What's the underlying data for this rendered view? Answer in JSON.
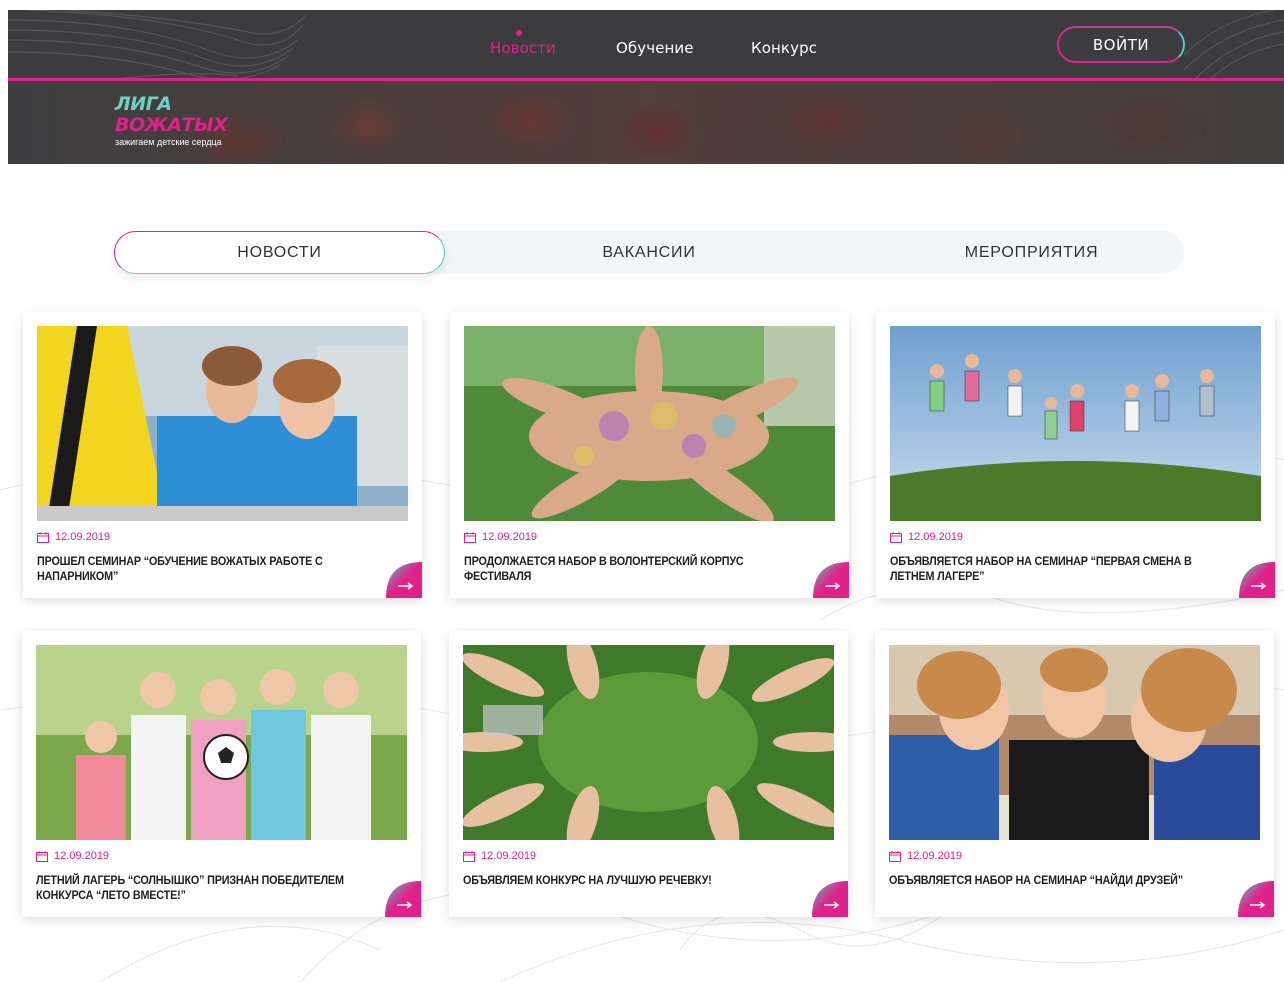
{
  "header": {
    "nav": [
      {
        "label": "Новости",
        "active": true
      },
      {
        "label": "Обучение",
        "active": false
      },
      {
        "label": "Конкурс",
        "active": false
      }
    ],
    "login_label": "ВОЙТИ",
    "logo": {
      "line1": "ЛИГА",
      "line2": "ВОЖАТЫХ",
      "tagline": "зажигаем детские сердца"
    }
  },
  "tabs": [
    {
      "label": "НОВОСТИ",
      "active": true
    },
    {
      "label": "ВАКАНСИИ",
      "active": false
    },
    {
      "label": "МЕРОПРИЯТИЯ",
      "active": false
    }
  ],
  "news": [
    {
      "date": "12.09.2019",
      "title": "ПРОШЕЛ СЕМИНАР “ОБУЧЕНИЕ ВОЖАТЫХ РАБОТЕ С НАПАРНИКОМ”",
      "image": "counselors-photo"
    },
    {
      "date": "12.09.2019",
      "title": "ПРОДОЛЖАЕТСЯ НАБОР В ВОЛОНТЕРСКИЙ КОРПУС ФЕСТИВАЛЯ",
      "image": "painted-hands-photo"
    },
    {
      "date": "12.09.2019",
      "title": "ОБЪЯВЛЯЕТСЯ НАБОР НА СЕМИНАР “ПЕРВАЯ СМЕНА В ЛЕТНЕМ ЛАГЕРЕ”",
      "image": "jumping-kids-photo"
    },
    {
      "date": "12.09.2019",
      "title": "ЛЕТНИЙ ЛАГЕРЬ “СОЛНЫШКО” ПРИЗНАН ПОБЕДИТЕЛЕМ КОНКУРСА “ЛЕТО ВМЕСТЕ!”",
      "image": "kids-with-ball-photo"
    },
    {
      "date": "12.09.2019",
      "title": "ОБЪЯВЛЯЕМ КОНКУРС НА ЛУЧШУЮ РЕЧЕВКУ!",
      "image": "feet-circle-photo"
    },
    {
      "date": "12.09.2019",
      "title": "ОБЪЯВЛЯЕТСЯ НАБОР НА СЕМИНАР “НАЙДИ ДРУЗЕЙ”",
      "image": "teens-map-photo"
    }
  ],
  "colors": {
    "accent": "#e0218a",
    "teal": "#52c7c0",
    "header_bg": "#3c3c3e"
  }
}
